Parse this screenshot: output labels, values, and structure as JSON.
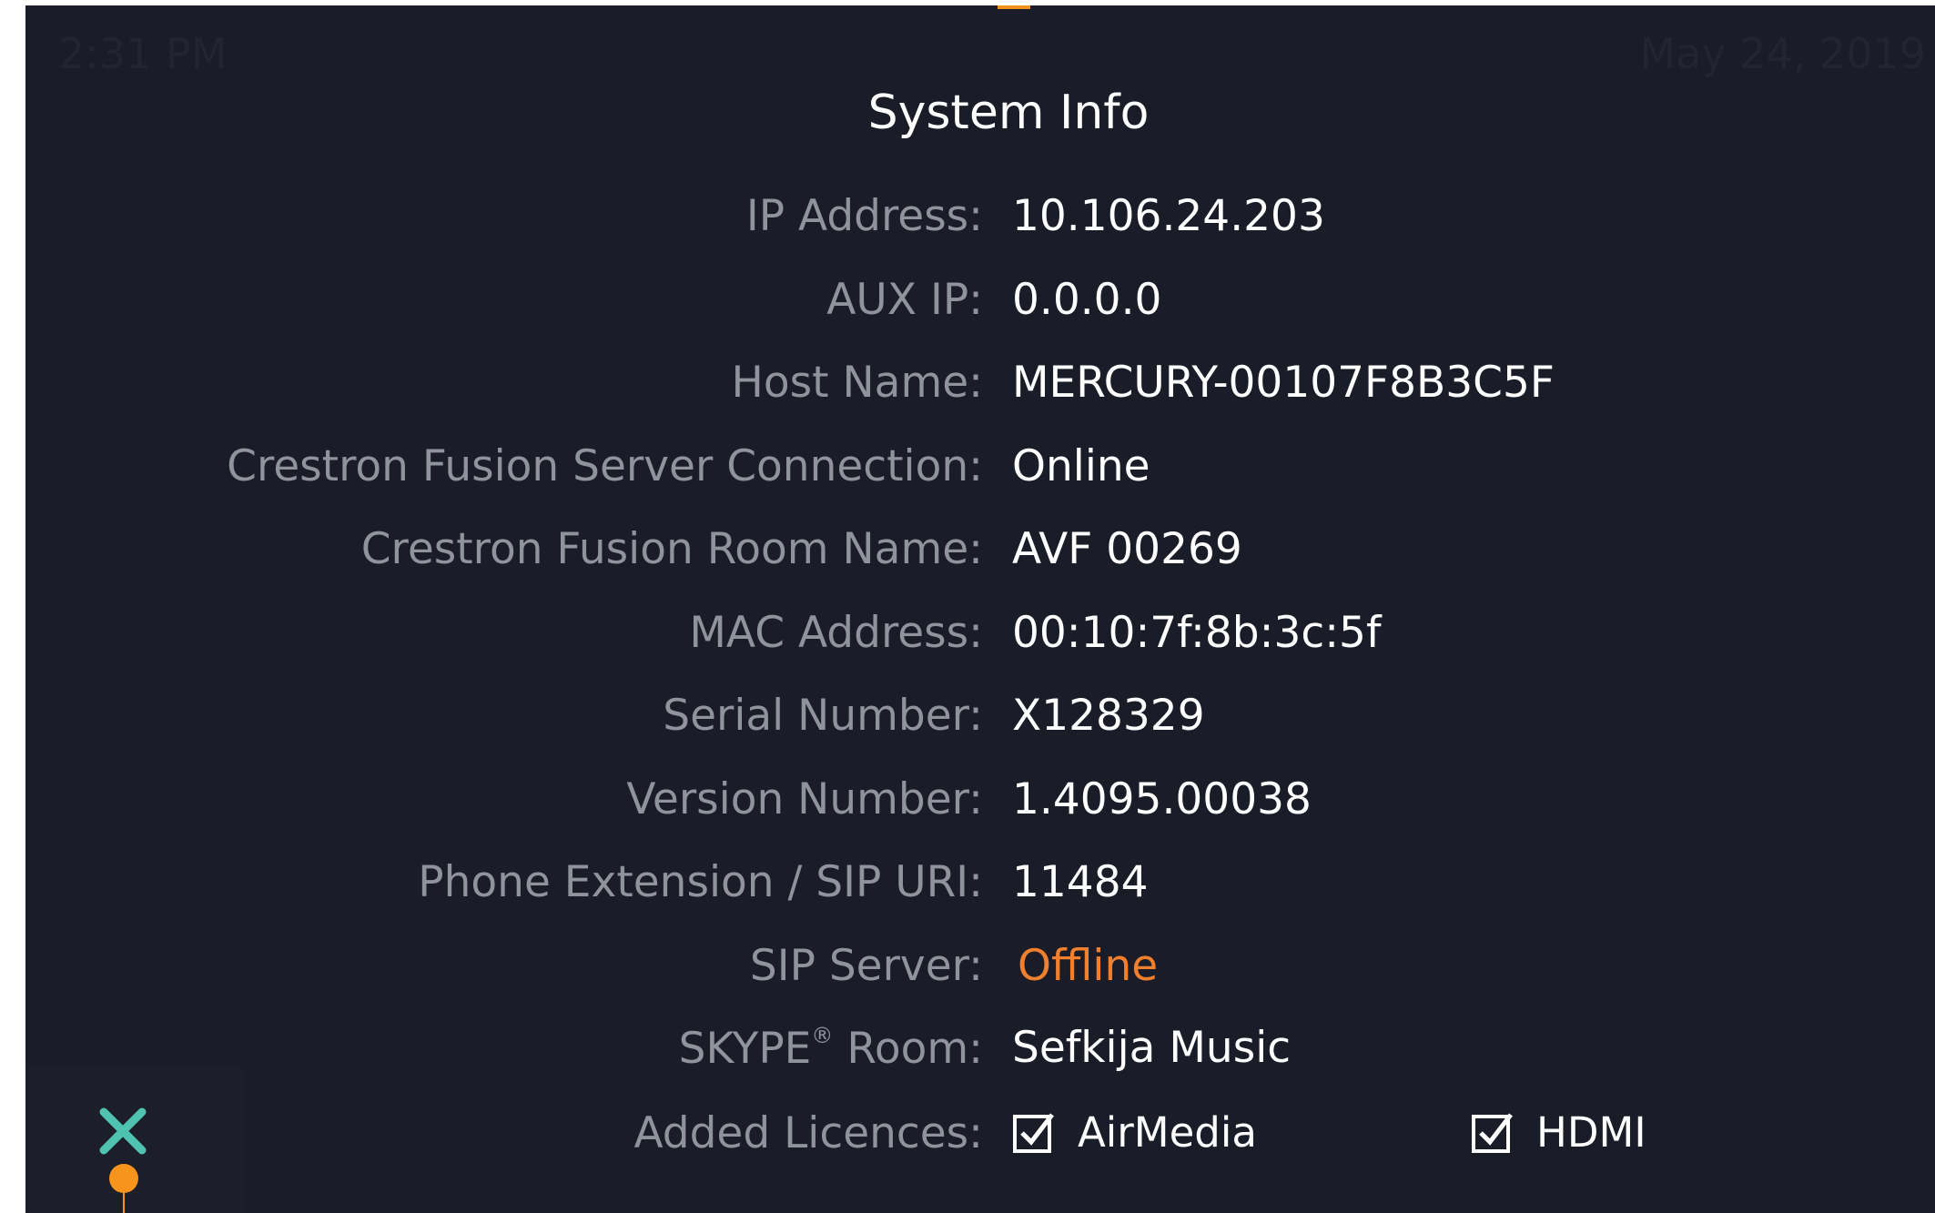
{
  "status_bar": {
    "time": "2:31 PM",
    "date": "May 24, 2019"
  },
  "dialog": {
    "title": "System Info",
    "rows": [
      {
        "label": "IP Address:",
        "value": "10.106.24.203"
      },
      {
        "label": "AUX IP:",
        "value": "0.0.0.0"
      },
      {
        "label": "Host Name:",
        "value": "MERCURY-00107F8B3C5F"
      },
      {
        "label": "Crestron Fusion Server Connection:",
        "value": "Online"
      },
      {
        "label": "Crestron Fusion Room Name:",
        "value": "AVF 00269"
      },
      {
        "label": "MAC Address:",
        "value": "00:10:7f:8b:3c:5f"
      },
      {
        "label": "Serial Number:",
        "value": "X128329"
      },
      {
        "label": "Version Number:",
        "value": "1.4095.00038"
      },
      {
        "label": "Phone Extension / SIP URI:",
        "value": "11484"
      },
      {
        "label": "SIP Server:",
        "value": "Offline"
      }
    ],
    "skype": {
      "label_prefix": "SKYPE",
      "label_sup": "®",
      "label_suffix": " Room:",
      "value": "Sefkija Music"
    },
    "licences": {
      "label": "Added Licences:",
      "items": [
        {
          "label": "AirMedia",
          "checked": true
        },
        {
          "label": "HDMI",
          "checked": true
        }
      ]
    }
  },
  "colors": {
    "background": "#1a1c28",
    "label": "#8f939c",
    "value": "#ffffff",
    "offline": "#f07f2e",
    "accent": "#f7941d",
    "close_icon": "#4fc3b0"
  },
  "icons": {
    "close": "close-icon",
    "checkbox": "checkbox-checked-icon"
  }
}
